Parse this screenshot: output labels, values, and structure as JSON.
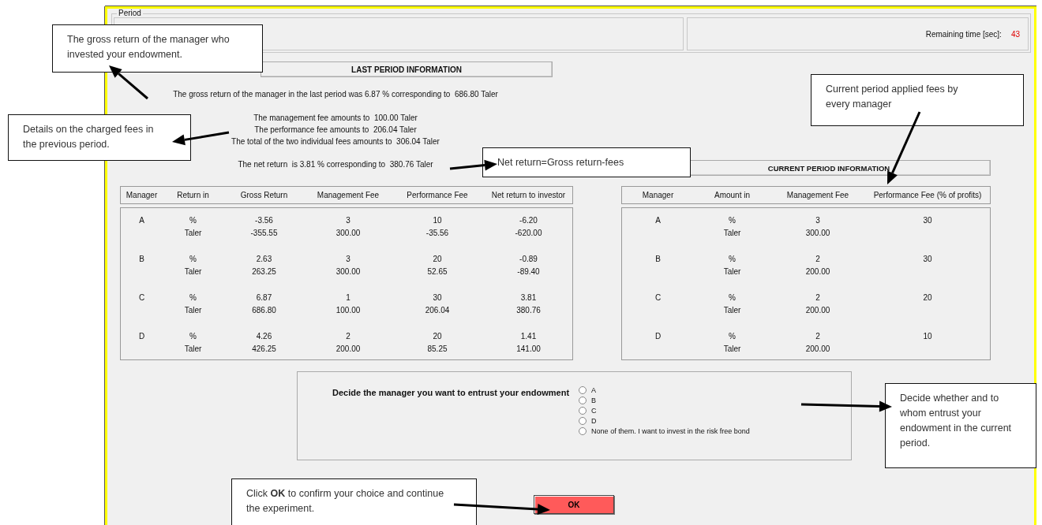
{
  "window": {
    "period_label": "Period",
    "remaining_time": {
      "label": "Remaining time [sec]:",
      "value": "43"
    }
  },
  "last_period": {
    "title": "LAST PERIOD INFORMATION",
    "gross_line": "The gross return of the manager in the last period was 6.87 % corresponding to  686.80 Taler",
    "fee_lines": [
      "The management fee amounts to  100.00 Taler",
      "The performance fee amounts to  206.04 Taler",
      "The total of the two individual fees amounts to  306.04 Taler"
    ],
    "net_line": "The net return  is 3.81 % corresponding to  380.76 Taler",
    "table": {
      "columns": [
        "Manager",
        "Return in",
        "Gross Return",
        "Management Fee",
        "Performance Fee",
        "Net return to investor"
      ],
      "rows": [
        {
          "manager": "A",
          "lines": [
            [
              "%",
              "-3.56",
              "3",
              "10",
              "-6.20"
            ],
            [
              "Taler",
              "-355.55",
              "300.00",
              "-35.56",
              "-620.00"
            ]
          ]
        },
        {
          "manager": "B",
          "lines": [
            [
              "%",
              "2.63",
              "3",
              "20",
              "-0.89"
            ],
            [
              "Taler",
              "263.25",
              "300.00",
              "52.65",
              "-89.40"
            ]
          ]
        },
        {
          "manager": "C",
          "lines": [
            [
              "%",
              "6.87",
              "1",
              "30",
              "3.81"
            ],
            [
              "Taler",
              "686.80",
              "100.00",
              "206.04",
              "380.76"
            ]
          ]
        },
        {
          "manager": "D",
          "lines": [
            [
              "%",
              "4.26",
              "2",
              "20",
              "1.41"
            ],
            [
              "Taler",
              "426.25",
              "200.00",
              "85.25",
              "141.00"
            ]
          ]
        }
      ]
    }
  },
  "current_period": {
    "title": "CURRENT PERIOD INFORMATION",
    "table": {
      "columns": [
        "Manager",
        "Amount in",
        "Management Fee",
        "Performance Fee (% of profits)"
      ],
      "rows": [
        {
          "manager": "A",
          "lines": [
            [
              "%",
              "3",
              "30"
            ],
            [
              "Taler",
              "300.00"
            ]
          ]
        },
        {
          "manager": "B",
          "lines": [
            [
              "%",
              "2",
              "30"
            ],
            [
              "Taler",
              "200.00"
            ]
          ]
        },
        {
          "manager": "C",
          "lines": [
            [
              "%",
              "2",
              "20"
            ],
            [
              "Taler",
              "200.00"
            ]
          ]
        },
        {
          "manager": "D",
          "lines": [
            [
              "%",
              "2",
              "10"
            ],
            [
              "Taler",
              "200.00"
            ]
          ]
        }
      ]
    }
  },
  "decision": {
    "prompt": "Decide the manager you want to entrust your endowment",
    "options": [
      {
        "label": "A",
        "selected": false
      },
      {
        "label": "B",
        "selected": false
      },
      {
        "label": "C",
        "selected": false
      },
      {
        "label": "D",
        "selected": false
      },
      {
        "label": "None of them. I want to invest in the risk free bond",
        "selected": false
      }
    ]
  },
  "ok_button": "OK",
  "callouts": [
    {
      "text": "The gross return of the manager who invested your endowment."
    },
    {
      "text": "Details on the charged fees in the previous period."
    },
    {
      "text": "Net return=Gross return-fees"
    },
    {
      "text": "Current period applied fees by every manager"
    },
    {
      "text": "Decide whether and to whom entrust your endowment in the current period."
    },
    {
      "text": "Click **OK** to confirm your choice and continue the experiment."
    }
  ]
}
